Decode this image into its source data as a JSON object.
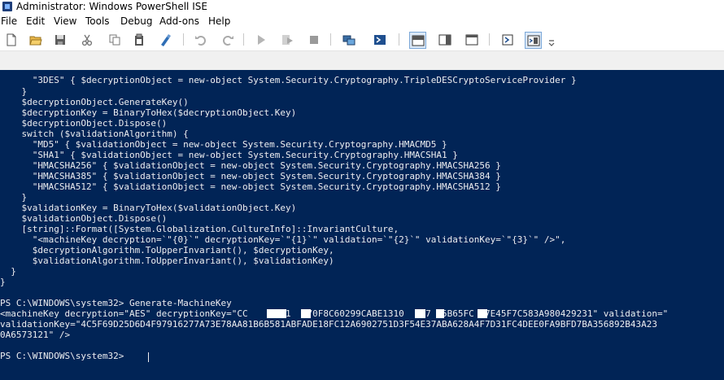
{
  "window": {
    "title": "Administrator: Windows PowerShell ISE"
  },
  "menu": [
    "File",
    "Edit",
    "View",
    "Tools",
    "Debug",
    "Add-ons",
    "Help"
  ],
  "toolbar": {
    "icons": [
      "new-file-icon",
      "open-folder-icon",
      "save-icon",
      "cut-icon",
      "copy-icon",
      "paste-icon",
      "clear-console-icon",
      "undo-icon",
      "redo-icon",
      "run-script-icon",
      "run-selection-icon",
      "stop-icon",
      "new-remote-tab-icon",
      "start-powershell-icon",
      "script-pane-top-icon",
      "script-pane-right-icon",
      "script-pane-maximized-icon",
      "show-command-icon",
      "show-addon-tools-icon",
      "toolbar-overflow-icon"
    ]
  },
  "console": {
    "lines": [
      "      \"3DES\" { $decryptionObject = new-object System.Security.Cryptography.TripleDESCryptoServiceProvider }",
      "    }",
      "    $decryptionObject.GenerateKey()",
      "    $decryptionKey = BinaryToHex($decryptionObject.Key)",
      "    $decryptionObject.Dispose()",
      "    switch ($validationAlgorithm) {",
      "      \"MD5\" { $validationObject = new-object System.Security.Cryptography.HMACMD5 }",
      "      \"SHA1\" { $validationObject = new-object System.Security.Cryptography.HMACSHA1 }",
      "      \"HMACSHA256\" { $validationObject = new-object System.Security.Cryptography.HMACSHA256 }",
      "      \"HMACSHA385\" { $validationObject = new-object System.Security.Cryptography.HMACSHA384 }",
      "      \"HMACSHA512\" { $validationObject = new-object System.Security.Cryptography.HMACSHA512 }",
      "    }",
      "    $validationKey = BinaryToHex($validationObject.Key)",
      "    $validationObject.Dispose()",
      "    [string]::Format([System.Globalization.CultureInfo]::InvariantCulture,",
      "      \"<machineKey decryption=`\"{0}`\" decryptionKey=`\"{1}`\" validation=`\"{2}`\" validationKey=`\"{3}`\" />\",",
      "      $decryptionAlgorithm.ToUpperInvariant(), $decryptionKey,",
      "      $validationAlgorithm.ToUpperInvariant(), $validationKey)",
      "  }",
      "}",
      "",
      "PS C:\\WINDOWS\\system32> Generate-MachineKey",
      "<machineKey decryption=\"AES\" decryptionKey=\"CC      31  970F8C60299CABE1310  B57  5B65FC  7E45F7C583A980429231\" validation=\"",
      "validationKey=\"4C5F69D25D6D4F97916277A73E78AA81B6B581ABFADE18FC12A6902751D3F54E37ABA628A4F7D31FC4DEE0FA9BFD7BA356892B43A23",
      "0A6573121\" />",
      "",
      "PS C:\\WINDOWS\\system32> "
    ]
  }
}
